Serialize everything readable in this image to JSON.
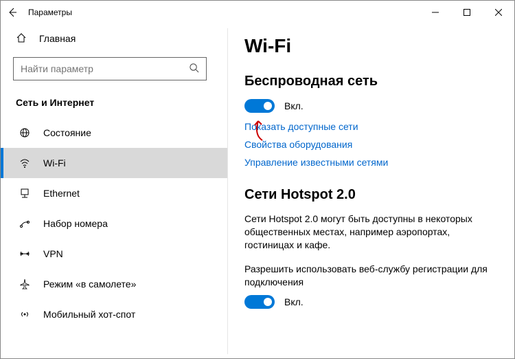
{
  "titlebar": {
    "title": "Параметры"
  },
  "sidebar": {
    "home": "Главная",
    "search_placeholder": "Найти параметр",
    "category": "Сеть и Интернет",
    "items": [
      {
        "label": "Состояние"
      },
      {
        "label": "Wi-Fi"
      },
      {
        "label": "Ethernet"
      },
      {
        "label": "Набор номера"
      },
      {
        "label": "VPN"
      },
      {
        "label": "Режим «в самолете»"
      },
      {
        "label": "Мобильный хот-спот"
      }
    ]
  },
  "content": {
    "title": "Wi-Fi",
    "wireless_heading": "Беспроводная сеть",
    "wifi_toggle_label": "Вкл.",
    "link_show_networks": "Показать доступные сети",
    "link_hardware_props": "Свойства оборудования",
    "link_manage_known": "Управление известными сетями",
    "hotspot_heading": "Сети Hotspot 2.0",
    "hotspot_desc": "Сети Hotspot 2.0 могут быть доступны в некоторых общественных местах, например аэропортах, гостиницах и кафе.",
    "hotspot_allow_prompt": "Разрешить использовать веб-службу регистрации для подключения",
    "hotspot_toggle_label": "Вкл."
  }
}
